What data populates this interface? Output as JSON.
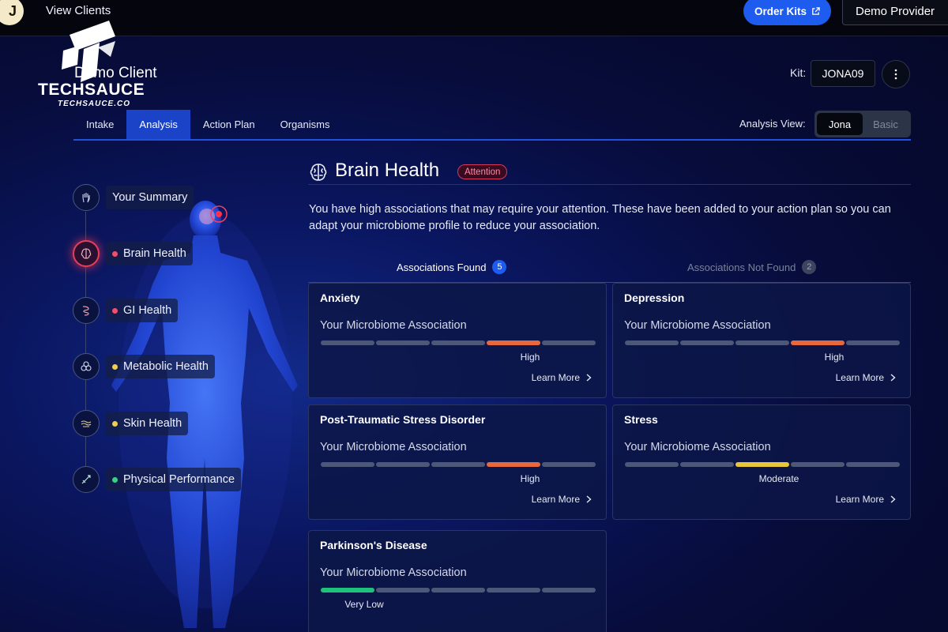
{
  "topbar": {
    "logo_letter": "J",
    "view_clients": "View Clients",
    "order_kits": "Order Kits",
    "demo_provider": "Demo Provider"
  },
  "watermark": {
    "brand": "TECHSAUCE",
    "site": "TECHSAUCE.CO"
  },
  "client": {
    "name": "Demo Client",
    "kit_label": "Kit:",
    "kit_id": "JONA09"
  },
  "tabs": [
    {
      "label": "Intake",
      "active": false
    },
    {
      "label": "Analysis",
      "active": true
    },
    {
      "label": "Action Plan",
      "active": false
    },
    {
      "label": "Organisms",
      "active": false
    }
  ],
  "analysis_view": {
    "label": "Analysis View:",
    "options": [
      "Jona",
      "Basic"
    ],
    "selected": "Jona"
  },
  "nav": [
    {
      "label": "Your Summary",
      "icon": "hand-icon",
      "dot": null
    },
    {
      "label": "Brain Health",
      "icon": "brain-icon",
      "dot": "#f0506a",
      "active": true
    },
    {
      "label": "GI Health",
      "icon": "gut-icon",
      "dot": "#f0506a"
    },
    {
      "label": "Metabolic Health",
      "icon": "cells-icon",
      "dot": "#f2cc4a"
    },
    {
      "label": "Skin Health",
      "icon": "skin-icon",
      "dot": "#f2cc4a"
    },
    {
      "label": "Physical Performance",
      "icon": "muscle-icon",
      "dot": "#35d28a"
    }
  ],
  "section": {
    "title": "Brain Health",
    "badge": "Attention",
    "description": "You have high associations that may require your attention. These have been added to your action plan so you can adapt your microbiome profile to reduce your association."
  },
  "subtabs": {
    "found_label": "Associations Found",
    "found_count": "5",
    "not_found_label": "Associations Not Found",
    "not_found_count": "2"
  },
  "card_common": {
    "subtitle": "Your Microbiome Association",
    "learn_more": "Learn More"
  },
  "cards": [
    {
      "title": "Anxiety",
      "level": "High",
      "level_index": 3,
      "level_color": "#e8683e"
    },
    {
      "title": "Depression",
      "level": "High",
      "level_index": 3,
      "level_color": "#e8683e"
    },
    {
      "title": "Post-Traumatic Stress Disorder",
      "level": "High",
      "level_index": 3,
      "level_color": "#e8683e"
    },
    {
      "title": "Stress",
      "level": "Moderate",
      "level_index": 2,
      "level_color": "#e8c63a"
    },
    {
      "title": "Parkinson's Disease",
      "level": "Very Low",
      "level_index": 0,
      "level_color": "#1ec27a"
    }
  ],
  "colors": {
    "accent": "#1e5cf0",
    "active_tab": "#1a43c8",
    "attention": "#d23a5a"
  }
}
